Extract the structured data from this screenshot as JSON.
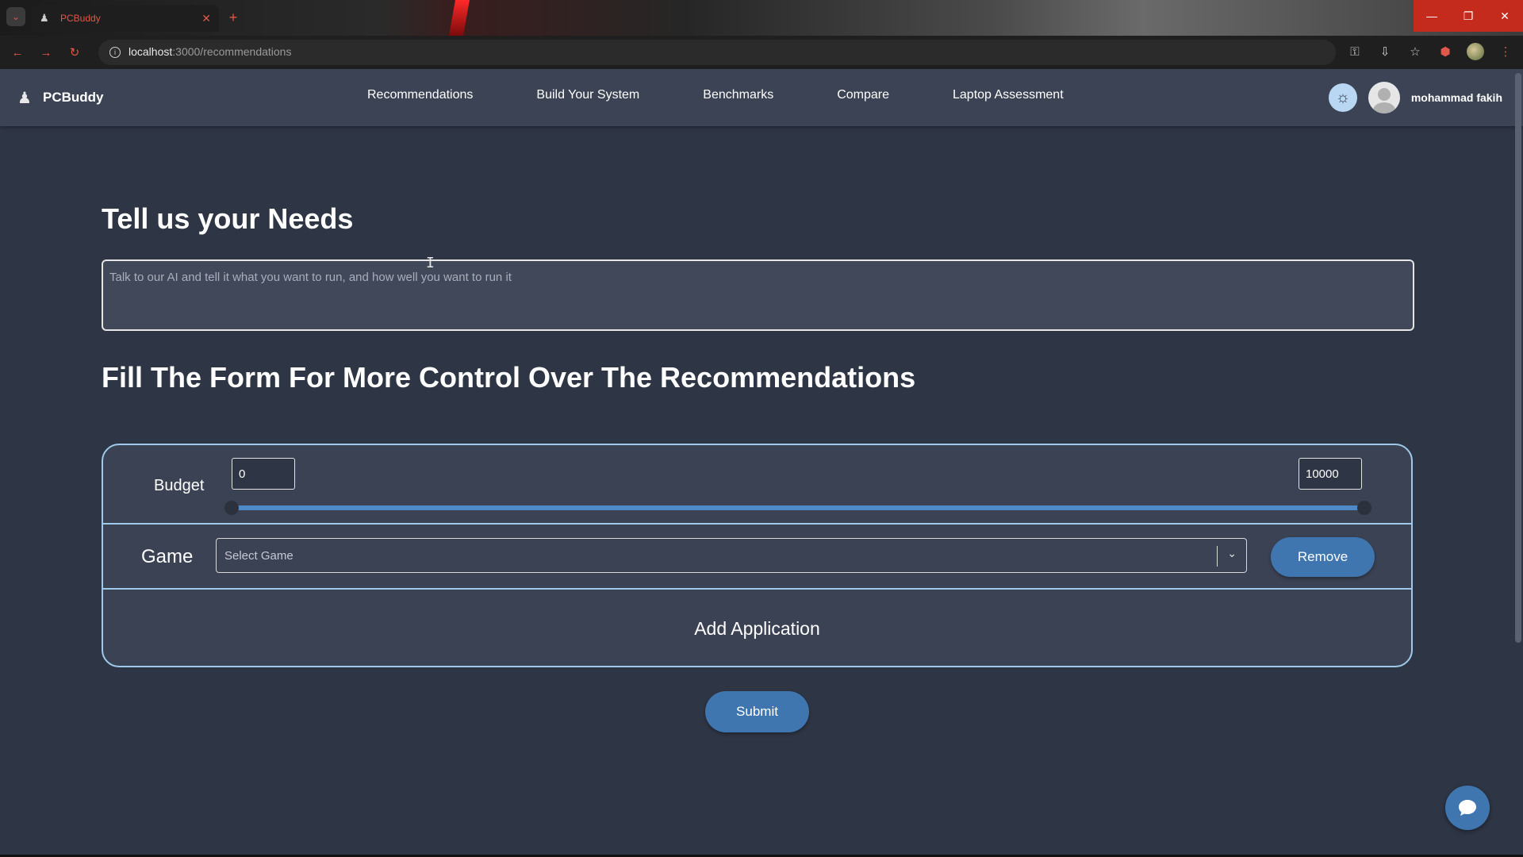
{
  "browser": {
    "tab_title": "PCBuddy",
    "url_host": "localhost",
    "url_path": ":3000/recommendations",
    "window_buttons": [
      "minimize-icon",
      "restore-icon",
      "close-icon"
    ]
  },
  "nav": {
    "brand": "PCBuddy",
    "links": [
      "Recommendations",
      "Build Your System",
      "Benchmarks",
      "Compare",
      "Laptop Assessment"
    ],
    "username": "mohammad fakih"
  },
  "main": {
    "needs_title": "Tell us your Needs",
    "needs_placeholder": "Talk to our AI and tell it what you want to run, and how well you want to run it",
    "form_title": "Fill The Form For More Control Over The Recommendations",
    "budget": {
      "label": "Budget",
      "min_value": "0",
      "max_value": "10000"
    },
    "game": {
      "label": "Game",
      "select_placeholder": "Select Game",
      "remove_label": "Remove"
    },
    "add_application_label": "Add Application",
    "submit_label": "Submit"
  },
  "colors": {
    "page_bg": "#2e3544",
    "nav_bg": "#3b4354",
    "accent": "#3f76b0",
    "card_border": "#9fc9ea"
  }
}
